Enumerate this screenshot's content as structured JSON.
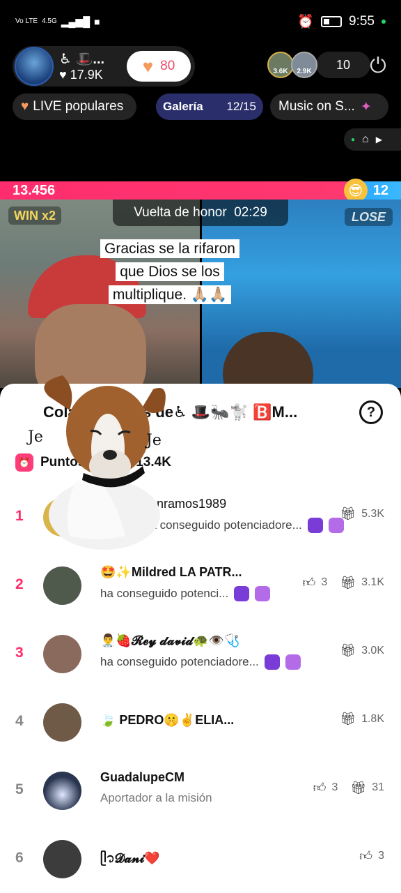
{
  "status_bar": {
    "carrier": "Vo LTE",
    "network": "4.5G",
    "time": "9:55"
  },
  "host": {
    "name": "♿ 🎩...",
    "likes": "17.9K",
    "like_count": "80"
  },
  "viewers": {
    "avatar1_label": "3.6K",
    "avatar2_label": "2.9K",
    "count": "10"
  },
  "pills": {
    "live_label": "LIVE populares",
    "gallery_label": "Galería",
    "gallery_progress": "12/15",
    "music_label": "Music on S..."
  },
  "battle": {
    "left_score": "13.456",
    "right_score": "12",
    "win_label": "WIN x2",
    "lose_label": "LOSE",
    "timer_label": "Vuelta de honor",
    "timer_value": "02:29",
    "caption": "Gracias se la rifaron que Dios se los multiplique. 🙏🏼🙏🏼"
  },
  "sheet": {
    "title": "Colaboradores de♿ 🎩🐜🐩 🅱️M...",
    "help_label": "?",
    "points_label": "Puntos totales:13.4K",
    "rows": [
      {
        "rank": "1",
        "name": "conramos1989",
        "sub": "ha conseguido potenciadore...",
        "gifts": "5.3K",
        "likes": ""
      },
      {
        "rank": "2",
        "name": "🤩✨Mildred LA PATR...",
        "sub": "ha conseguido potenci...",
        "likes": "3",
        "gifts": "3.1K"
      },
      {
        "rank": "3",
        "name": "👨‍⚕️🍓𝓡𝓮𝔂 𝓭𝓪𝓿𝓲𝓭🐢👁️🩺",
        "sub": "ha conseguido potenciadore...",
        "gifts": "3.0K",
        "likes": ""
      },
      {
        "rank": "4",
        "name": "🍃 PEDRO🤫✌️ELIA...",
        "sub": "",
        "gifts": "1.8K",
        "likes": ""
      },
      {
        "rank": "5",
        "name": "GuadalupeCM",
        "sub": "Aportador a la misión",
        "likes": "3",
        "gifts": "31"
      },
      {
        "rank": "6",
        "name": "ᥫ᭡𝓓𝓪𝓷𝓲❤️",
        "sub": "",
        "likes": "3",
        "gifts": ""
      }
    ]
  },
  "sticker": {
    "label_left": "Je",
    "label_right": "Je"
  }
}
